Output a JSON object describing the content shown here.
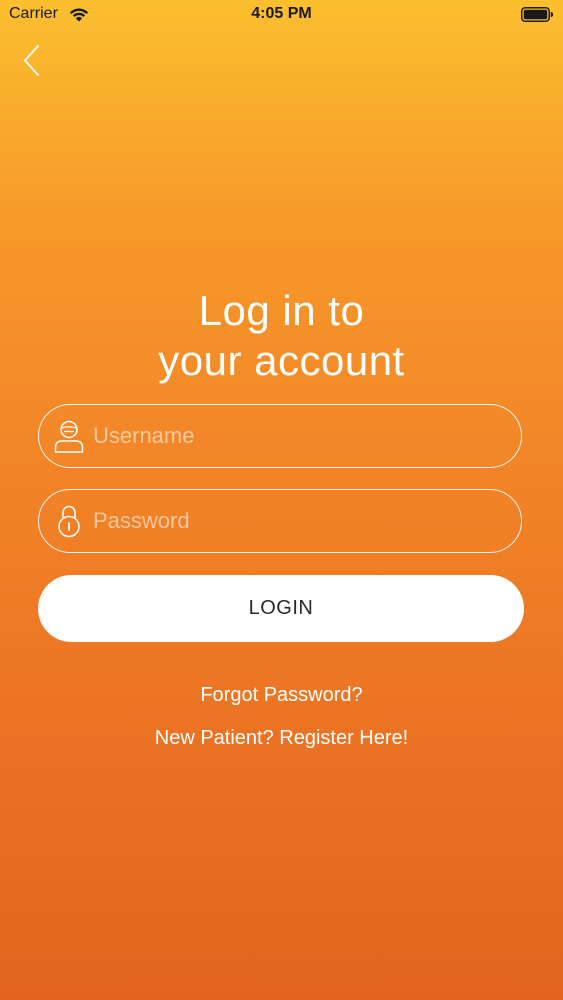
{
  "status_bar": {
    "carrier": "Carrier",
    "time": "4:05 PM",
    "wifi_icon": "wifi-icon",
    "battery_icon": "battery-full-icon"
  },
  "nav": {
    "back_icon": "chevron-left-icon"
  },
  "title": {
    "line1": "Log in to",
    "line2": "your account"
  },
  "form": {
    "username": {
      "icon": "user-icon",
      "placeholder": "Username",
      "value": ""
    },
    "password": {
      "icon": "lock-icon",
      "placeholder": "Password",
      "value": ""
    },
    "login_label": "LOGIN"
  },
  "links": {
    "forgot_password": "Forgot Password?",
    "register": "New Patient? Register Here!"
  },
  "colors": {
    "gradient_top": "#fbbf2e",
    "gradient_bottom": "#e4641f",
    "button_bg": "#ffffff",
    "button_text": "#2b2b2b"
  }
}
